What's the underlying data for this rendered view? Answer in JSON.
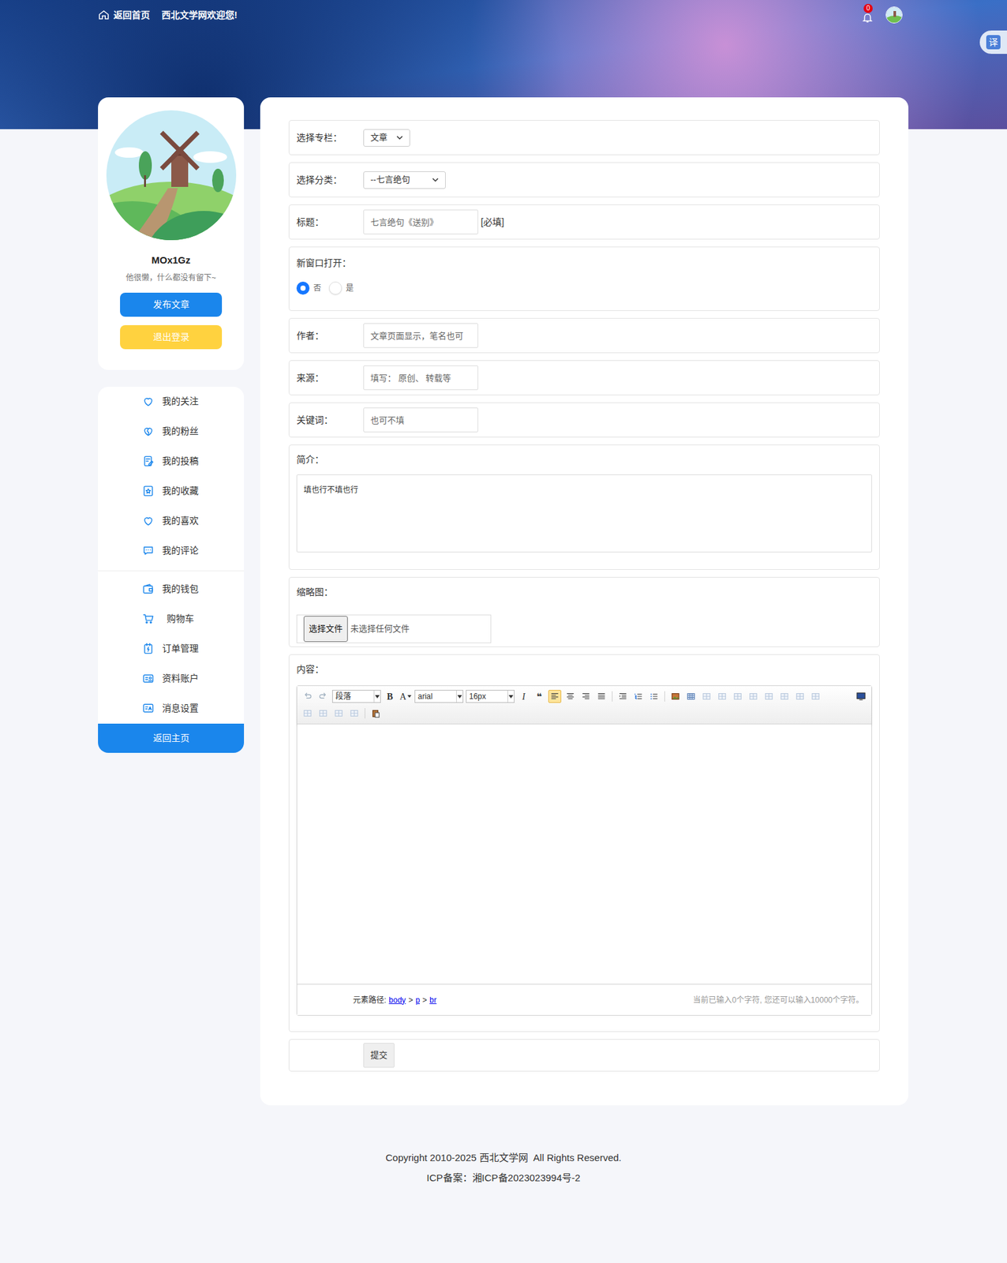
{
  "header": {
    "home": "返回首页",
    "welcome": "西北文学网欢迎您!",
    "notification_count": "0",
    "translate": "译"
  },
  "profile": {
    "name": "MOx1Gz",
    "bio": "他很懒，什么都没有留下~",
    "publish": "发布文章",
    "logout": "退出登录"
  },
  "menu": {
    "groups": [
      [
        "我的关注",
        "我的粉丝",
        "我的投稿",
        "我的收藏",
        "我的喜欢",
        "我的评论"
      ],
      [
        "我的钱包",
        "购物车",
        "订单管理",
        "资料账户",
        "消息设置"
      ]
    ],
    "home": "返回主页"
  },
  "form": {
    "column": {
      "label": "选择专栏：",
      "value": "文章"
    },
    "category": {
      "label": "选择分类：",
      "value": "--七言绝句"
    },
    "title": {
      "label": "标题：",
      "placeholder": "七言绝句《送别》",
      "hint": "[必填]"
    },
    "new_window": {
      "label": "新窗口打开：",
      "options": [
        {
          "label": "否",
          "selected": true
        },
        {
          "label": "是",
          "selected": false
        }
      ]
    },
    "author": {
      "label": "作者：",
      "placeholder": "文章页面显示，笔名也可"
    },
    "source": {
      "label": "来源：",
      "placeholder": "填写： 原创、 转载等"
    },
    "keywords": {
      "label": "关键词：",
      "placeholder": "也可不填"
    },
    "intro": {
      "label": "简介：",
      "value": "填也行不填也行"
    },
    "thumbnail": {
      "label": "缩略图：",
      "button": "选择文件",
      "status": "未选择任何文件"
    },
    "content": {
      "label": "内容："
    },
    "submit": "提交"
  },
  "editor": {
    "toolbar": {
      "format": "段落",
      "bold": "B",
      "font_color": "A",
      "font": "arial",
      "size": "16px",
      "italic": "I",
      "quote": "❝",
      "alignment": [
        {
          "selected": true
        },
        {
          "selected": false
        },
        {
          "selected": false
        },
        {
          "selected": false
        }
      ]
    },
    "path_label": "元素路径:",
    "path": [
      "body",
      "p",
      "br"
    ],
    "separator": ">",
    "counter": "当前已输入0个字符, 您还可以输入10000个字符。"
  },
  "footer": {
    "copyright": "Copyright 2010-2025 西北文学网  All Rights Reserved.",
    "icp": "ICP备案：湘ICP备2023023994号-2"
  }
}
